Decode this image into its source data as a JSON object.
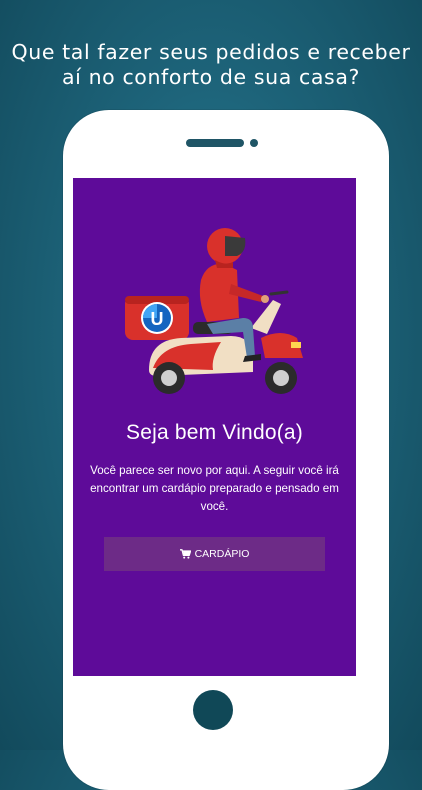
{
  "headline": {
    "line1": "Que tal fazer seus pedidos e receber",
    "line2": "aí no conforto de sua casa?"
  },
  "screen": {
    "welcome_title": "Seja bem Vindo(a)",
    "welcome_line1": "Você parece ser novo por aqui. A seguir você irá",
    "welcome_line2": "encontrar um cardápio preparado e pensado em você.",
    "menu_button_label": "CARDÁPIO",
    "menu_button_icon": "shopping-cart-icon",
    "box_logo_letter": "U"
  },
  "colors": {
    "background": "#1d6379",
    "screen": "#5e0b99",
    "button": "#6d2b87",
    "scooter_red": "#d9312b",
    "scooter_cream": "#f1dfc4"
  }
}
